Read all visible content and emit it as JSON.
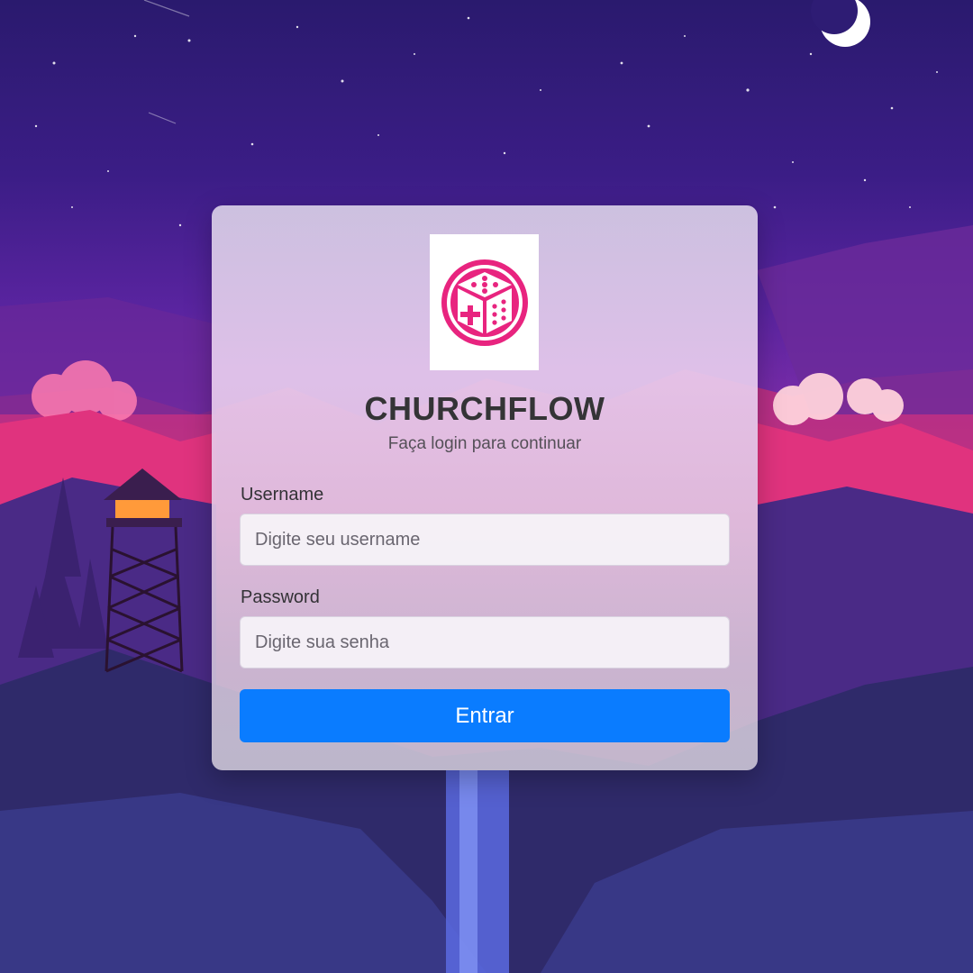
{
  "app": {
    "title": "CHURCHFLOW",
    "subtitle": "Faça login para continuar",
    "logo_icon": "dice-plus-icon",
    "brand_color": "#e8247f"
  },
  "form": {
    "username_label": "Username",
    "username_placeholder": "Digite seu username",
    "username_value": "",
    "password_label": "Password",
    "password_placeholder": "Digite sua senha",
    "password_value": "",
    "submit_label": "Entrar",
    "submit_color": "#0a7cff"
  },
  "background": {
    "description_icon": "night-mountain-landscape",
    "moon_icon": "crescent-moon-icon",
    "tower_icon": "lookout-tower-icon"
  }
}
